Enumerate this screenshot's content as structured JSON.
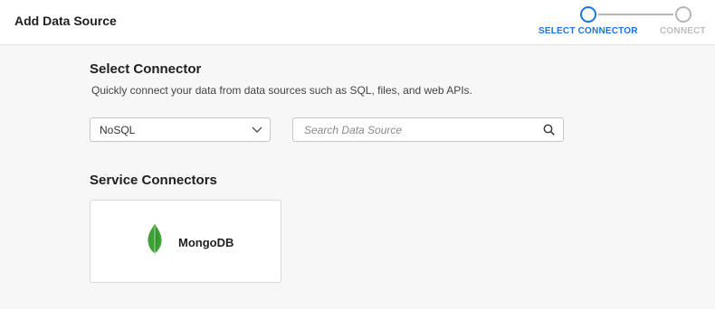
{
  "header": {
    "title": "Add Data Source",
    "steps": [
      {
        "label": "SELECT CONNECTOR",
        "state": "active"
      },
      {
        "label": "CONNECT",
        "state": "inactive"
      }
    ]
  },
  "main": {
    "title": "Select Connector",
    "description": "Quickly connect your data from data sources such as SQL, files, and web APIs.",
    "filter": {
      "selected": "NoSQL"
    },
    "search": {
      "placeholder": "Search Data Source",
      "value": ""
    },
    "section_title": "Service Connectors",
    "connectors": [
      {
        "label": "MongoDB",
        "icon": "mongodb-leaf-icon"
      }
    ]
  },
  "colors": {
    "accent": "#1a73e8",
    "inactive": "#b5b5b5",
    "mongodb_green": "#3fa037"
  }
}
